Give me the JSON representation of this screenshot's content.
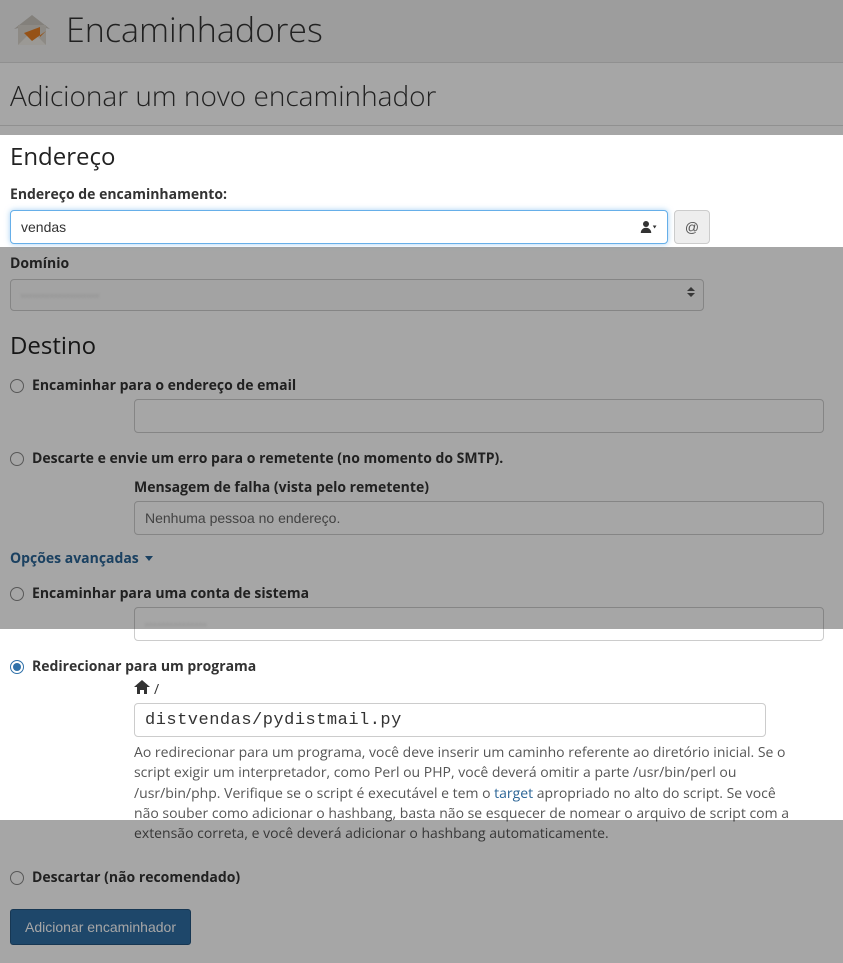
{
  "header": {
    "app_title": "Encaminhadores"
  },
  "page": {
    "title": "Adicionar um novo encaminhador"
  },
  "address": {
    "section_title": "Endereço",
    "field_label": "Endereço de encaminhamento:",
    "value": "vendas",
    "at_label": "@",
    "domain_label": "Domínio",
    "domain_value": "···················"
  },
  "destination": {
    "section_title": "Destino",
    "forward_email": {
      "label": "Encaminhar para o endereço de email",
      "value": ""
    },
    "discard_error": {
      "label": "Descarte e envie um erro para o remetente (no momento do SMTP).",
      "fail_label": "Mensagem de falha (vista pelo remetente)",
      "fail_value": "Nenhuma pessoa no endereço."
    },
    "advanced_label": "Opções avançadas",
    "system_account": {
      "label": "Encaminhar para uma conta de sistema",
      "value": "···············"
    },
    "pipe": {
      "label": "Redirecionar para um programa",
      "path_prefix": "/",
      "value": "distvendas/pydistmail.py",
      "help_a": "Ao redirecionar para um programa, você deve inserir um caminho referente ao diretório inicial. Se o script exigir um interpretador, como Perl ou PHP, você deverá omitir a parte /usr/bin/perl ou /usr/bin/php. Verifique se o script é executável e tem o ",
      "help_link": "target",
      "help_b": " apropriado no alto do script. Se você não souber como adicionar o hashbang, basta não se esquecer de nomear o arquivo de script com a extensão correta, e você deverá adicionar o hashbang automaticamente."
    },
    "discard": {
      "label": "Descartar (não recomendado)"
    }
  },
  "submit_label": "Adicionar encaminhador"
}
